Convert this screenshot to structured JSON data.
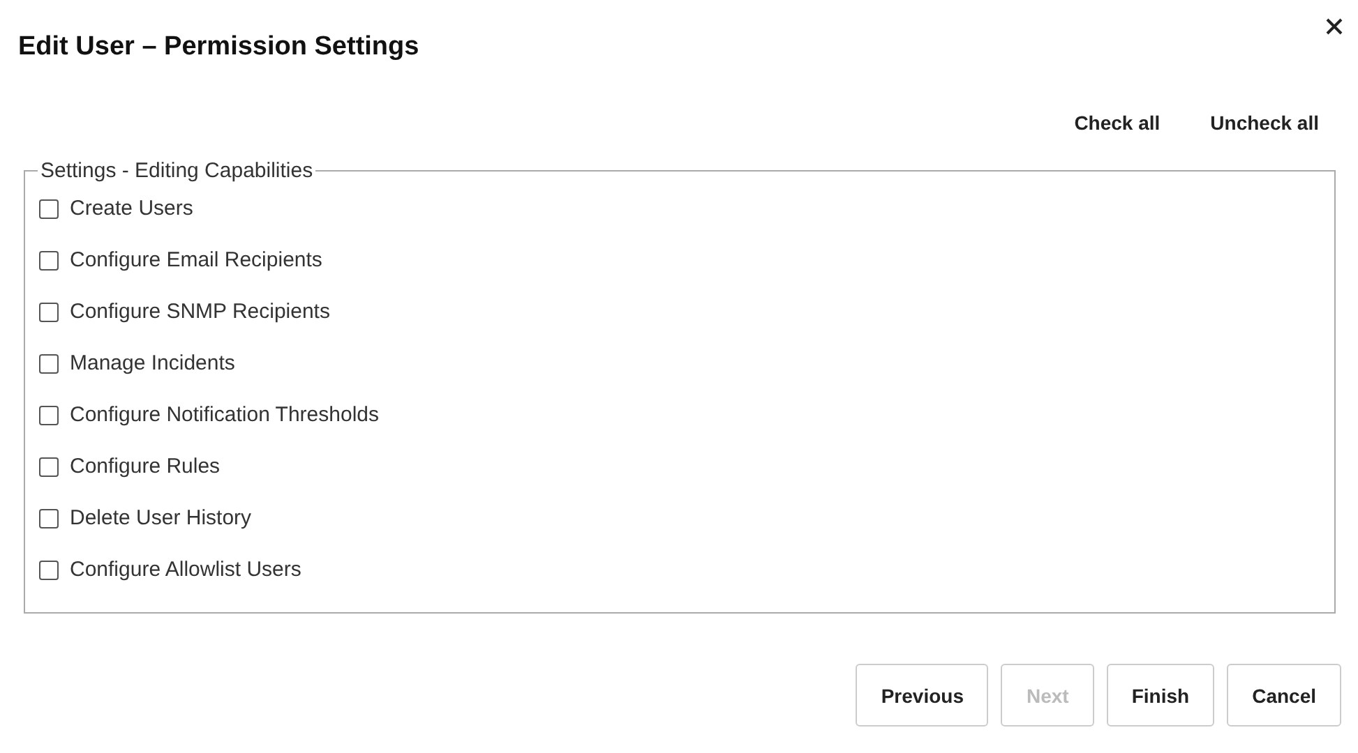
{
  "dialog": {
    "title": "Edit User – Permission Settings"
  },
  "bulk_actions": [
    {
      "label": "Check all"
    },
    {
      "label": "Uncheck all"
    }
  ],
  "group": {
    "legend": "Settings - Editing Capabilities",
    "permissions": [
      {
        "label": "Create Users",
        "checked": false
      },
      {
        "label": "Configure Email Recipients",
        "checked": false
      },
      {
        "label": "Configure SNMP Recipients",
        "checked": false
      },
      {
        "label": "Manage Incidents",
        "checked": false
      },
      {
        "label": "Configure Notification Thresholds",
        "checked": false
      },
      {
        "label": "Configure Rules",
        "checked": false
      },
      {
        "label": "Delete User History",
        "checked": false
      },
      {
        "label": "Configure Allowlist Users",
        "checked": false
      }
    ]
  },
  "buttons": [
    {
      "label": "Previous",
      "disabled": false
    },
    {
      "label": "Next",
      "disabled": true
    },
    {
      "label": "Finish",
      "disabled": false
    },
    {
      "label": "Cancel",
      "disabled": false
    }
  ]
}
